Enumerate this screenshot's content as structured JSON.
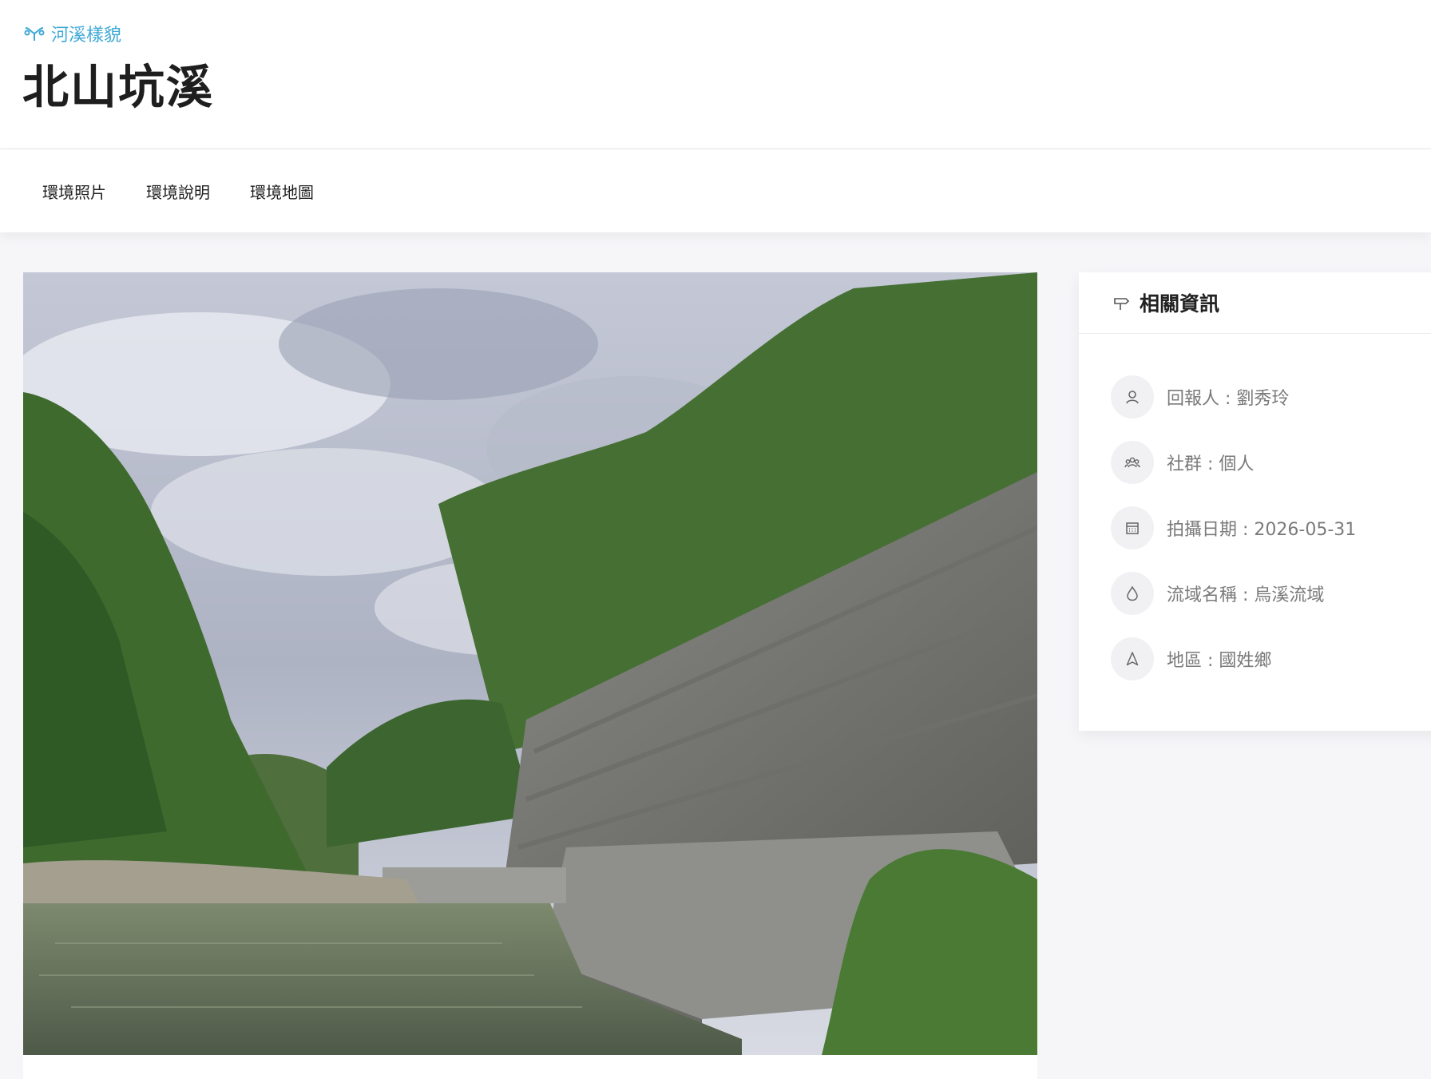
{
  "header": {
    "category_label": "河溪樣貌",
    "category_icon": "river-branch-icon",
    "title": "北山坑溪"
  },
  "tabs": [
    {
      "label": "環境照片"
    },
    {
      "label": "環境說明"
    },
    {
      "label": "環境地圖"
    }
  ],
  "photo": {
    "subject": "river-with-concrete-embankment"
  },
  "info_card": {
    "title": "相關資訊",
    "title_icon": "signpost-icon",
    "items": [
      {
        "icon": "user-icon",
        "text": "回報人 : 劉秀玲"
      },
      {
        "icon": "group-icon",
        "text": "社群 : 個人"
      },
      {
        "icon": "calendar-icon",
        "text": "拍攝日期 : 2026-05-31"
      },
      {
        "icon": "water-drop-icon",
        "text": "流域名稱 : 烏溪流域"
      },
      {
        "icon": "location-arrow-icon",
        "text": "地區 : 國姓鄉"
      }
    ]
  },
  "colors": {
    "accent": "#3fa9d6",
    "background": "#f6f6f9",
    "text_muted": "#7a7a7a"
  }
}
